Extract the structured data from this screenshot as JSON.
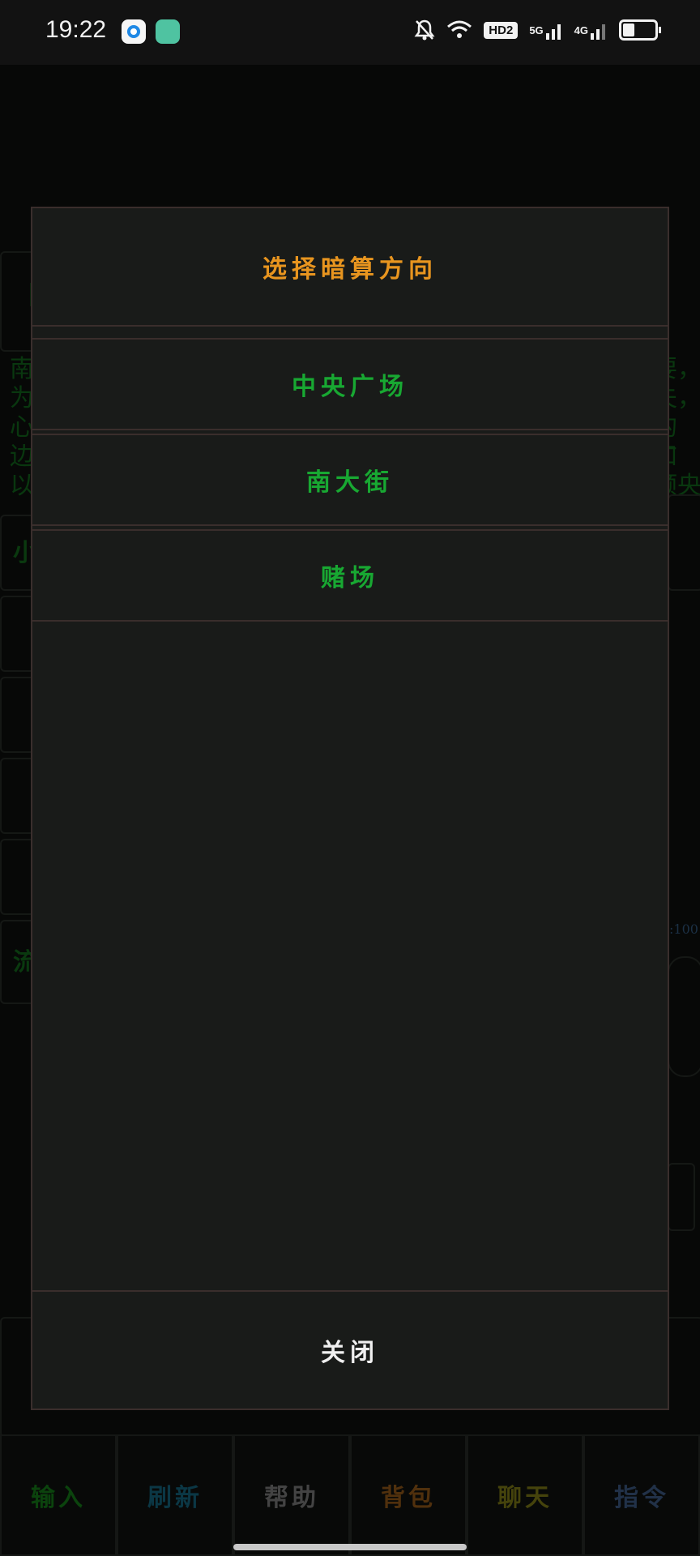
{
  "status_bar": {
    "time": "19:22",
    "hd_label": "HD2",
    "net_5g": "5G",
    "net_4g": "4G",
    "icons": [
      "app-blue-circle-icon",
      "app-green-icon",
      "mute-bell-icon",
      "wifi-icon",
      "hd-icon",
      "signal-5g-icon",
      "signal-4g-icon",
      "battery-icon"
    ]
  },
  "background": {
    "bracket": "【",
    "lines_left": [
      "南",
      "为",
      "心",
      "边",
      "以"
    ],
    "lines_right": [
      "要，",
      "夫，",
      "的广",
      "和倾",
      "央"
    ],
    "small_label": "小",
    "flow_label": "流",
    "stat_label": ":100"
  },
  "modal": {
    "title": "选择暗算方向",
    "options": [
      "中央广场",
      "南大街",
      "赌场"
    ],
    "close_label": "关闭"
  },
  "tabbar": {
    "tabs": [
      {
        "label": "输入",
        "color": "#0f5a12"
      },
      {
        "label": "刷新",
        "color": "#0f4a5c"
      },
      {
        "label": "帮助",
        "color": "#5a5a5a"
      },
      {
        "label": "背包",
        "color": "#6b4012"
      },
      {
        "label": "聊天",
        "color": "#5c5a10"
      },
      {
        "label": "指令",
        "color": "#2c4260"
      }
    ]
  },
  "colors": {
    "title": "#e8951f",
    "option": "#18a832",
    "close": "#f0f0f0",
    "modal_bg": "#191b19",
    "border": "#3a2e2c"
  }
}
